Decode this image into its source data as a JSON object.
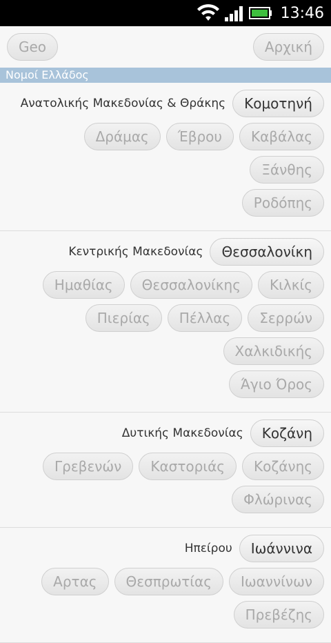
{
  "status": {
    "time": "13:46"
  },
  "topbar": {
    "geo_label": "Geo",
    "home_label": "Αρχική"
  },
  "section_title": "Νομοί Ελλάδος",
  "groups": [
    {
      "region": "Ανατολικής Μακεδονίας & Θράκης",
      "capital": "Κομοτηνή",
      "prefectures": [
        "Δράμας",
        "Έβρου",
        "Καβάλας",
        "Ξάνθης",
        "Ροδόπης"
      ]
    },
    {
      "region": "Κεντρικής Μακεδονίας",
      "capital": "Θεσσαλονίκη",
      "prefectures": [
        "Ημαθίας",
        "Θεσσαλονίκης",
        "Κιλκίς",
        "Πιερίας",
        "Πέλλας",
        "Σερρών",
        "Χαλκιδικής",
        "Άγιο Όρος"
      ]
    },
    {
      "region": "Δυτικής Μακεδονίας",
      "capital": "Κοζάνη",
      "prefectures": [
        "Γρεβενών",
        "Καστοριάς",
        "Κοζάνης",
        "Φλώρινας"
      ]
    },
    {
      "region": "Ηπείρου",
      "capital": "Ιωάννινα",
      "prefectures": [
        "Αρτας",
        "Θεσπρωτίας",
        "Ιωαννίνων",
        "Πρεβέζης"
      ]
    }
  ]
}
